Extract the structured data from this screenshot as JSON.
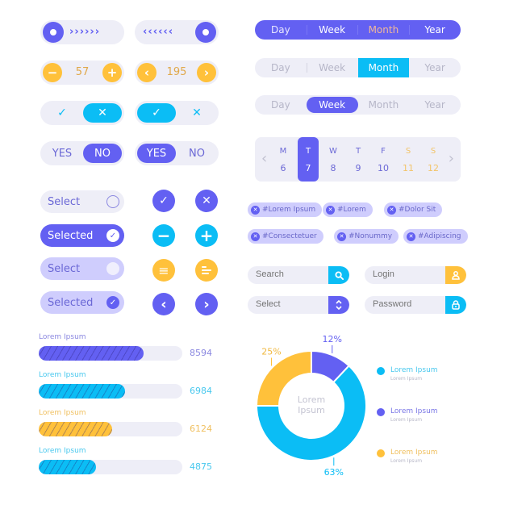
{
  "colors": {
    "purple": "#6360f2",
    "cyan": "#0bbdf5",
    "yellow": "#ffc13b",
    "track": "#eeeef7",
    "lavender": "#cfcdfd"
  },
  "sliders": [
    {
      "direction": "right",
      "chevrons": "››››››",
      "icon": "chevron-right"
    },
    {
      "direction": "left",
      "chevrons": "‹‹‹‹‹‹",
      "icon": "chevron-left"
    }
  ],
  "steppers": [
    {
      "value": "57",
      "dec": "−",
      "inc": "+"
    },
    {
      "value": "195",
      "dec": "‹",
      "inc": "›"
    }
  ],
  "icon_toggles": [
    {
      "left": "✓",
      "right": "✕",
      "active": "right"
    },
    {
      "left": "✓",
      "right": "✕",
      "active": "left"
    }
  ],
  "yes_no_toggles": [
    {
      "yes": "YES",
      "no": "NO",
      "active": "no"
    },
    {
      "yes": "YES",
      "no": "NO",
      "active": "yes"
    }
  ],
  "select_pills": [
    {
      "label": "Select",
      "state": "unselected"
    },
    {
      "label": "Selected",
      "state": "selected"
    },
    {
      "label": "Select",
      "state": "unselected-light"
    },
    {
      "label": "Selected",
      "state": "selected-light"
    }
  ],
  "round_buttons": [
    {
      "icon": "check",
      "glyph": "✓"
    },
    {
      "icon": "close",
      "glyph": "✕"
    },
    {
      "icon": "minus",
      "glyph": "−"
    },
    {
      "icon": "plus",
      "glyph": "+"
    },
    {
      "icon": "menu",
      "glyph": "≡"
    },
    {
      "icon": "align-left",
      "glyph": "≡"
    },
    {
      "icon": "chevron-left",
      "glyph": "‹"
    },
    {
      "icon": "chevron-right",
      "glyph": "›"
    }
  ],
  "progress": [
    {
      "label": "Lorem Ipsum",
      "value": "8594",
      "fraction": 0.73,
      "color": "#6360f2"
    },
    {
      "label": "Lorem Ipsum",
      "value": "6984",
      "fraction": 0.6,
      "color": "#0bbdf5"
    },
    {
      "label": "Lorem Ipsum",
      "value": "6124",
      "fraction": 0.51,
      "color": "#ffc13b"
    },
    {
      "label": "Lorem Ipsum",
      "value": "4875",
      "fraction": 0.4,
      "color": "#0bbdf5"
    }
  ],
  "segments": [
    {
      "options": [
        "Day",
        "Week",
        "Month",
        "Year"
      ],
      "active": "Month",
      "style": "dark"
    },
    {
      "options": [
        "Day",
        "Week",
        "Month",
        "Year"
      ],
      "active": "Month",
      "style": "cyan"
    },
    {
      "options": [
        "Day",
        "Week",
        "Month",
        "Year"
      ],
      "active": "Week",
      "style": "pill"
    }
  ],
  "calendar": {
    "prev": "‹",
    "next": "›",
    "days": [
      {
        "dow": "M",
        "date": "6",
        "weekend": false
      },
      {
        "dow": "T",
        "date": "7",
        "weekend": false,
        "selected": true
      },
      {
        "dow": "W",
        "date": "8",
        "weekend": false
      },
      {
        "dow": "T",
        "date": "9",
        "weekend": false
      },
      {
        "dow": "F",
        "date": "10",
        "weekend": false
      },
      {
        "dow": "S",
        "date": "11",
        "weekend": true
      },
      {
        "dow": "S",
        "date": "12",
        "weekend": true
      }
    ]
  },
  "tags": [
    [
      "#Lorem Ipsum",
      "#Lorem",
      "#Dolor Sit"
    ],
    [
      "#Consectetuer",
      "#Nonummy",
      "#Adipiscing"
    ]
  ],
  "inputs": {
    "search": {
      "placeholder": "Search",
      "icon": "search"
    },
    "select": {
      "placeholder": "Select",
      "icon": "chevron-up-down"
    },
    "login": {
      "placeholder": "Login",
      "icon": "user"
    },
    "password": {
      "placeholder": "Password",
      "icon": "lock"
    }
  },
  "chart_data": {
    "type": "pie",
    "title": "",
    "center_label": "Lorem Ipsum",
    "slices": [
      {
        "label": "Lorem Ipsum",
        "value": 12,
        "display": "12%",
        "color": "#6360f2"
      },
      {
        "label": "Lorem Ipsum",
        "value": 63,
        "display": "63%",
        "color": "#0bbdf5"
      },
      {
        "label": "Lorem Ipsum",
        "value": 25,
        "display": "25%",
        "color": "#ffc13b"
      }
    ],
    "legend_position": "right",
    "legend": [
      {
        "title": "Lorem Ipsum",
        "subtitle": "Lorem Ipsum",
        "color": "#0bbdf5"
      },
      {
        "title": "Lorem Ipsum",
        "subtitle": "Lorem Ipsum",
        "color": "#6360f2"
      },
      {
        "title": "Lorem Ipsum",
        "subtitle": "Lorem Ipsum",
        "color": "#ffc13b"
      }
    ]
  }
}
